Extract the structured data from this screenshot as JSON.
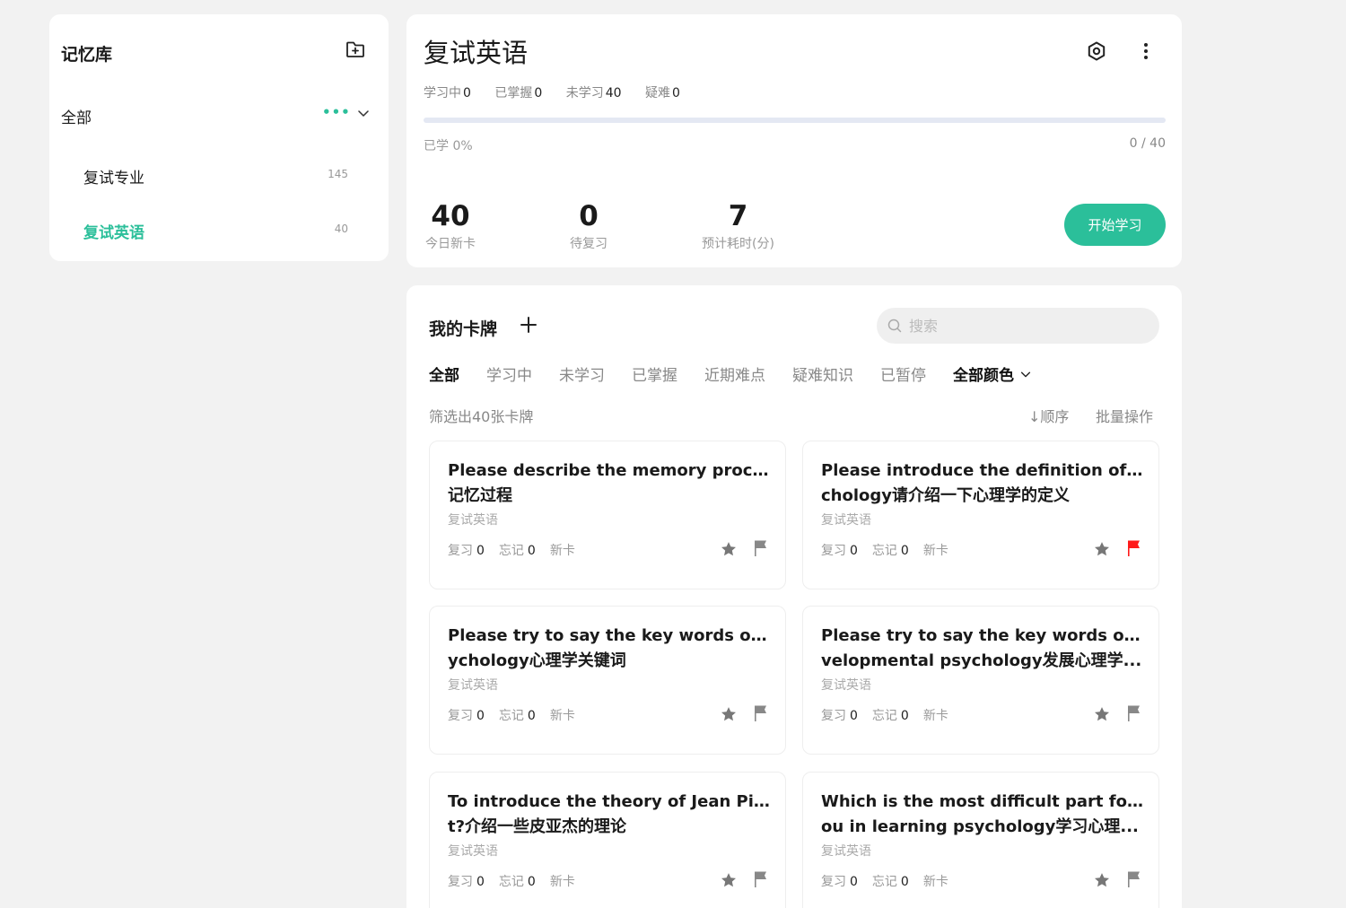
{
  "sidebar": {
    "title": "记忆库",
    "all_label": "全部",
    "items": [
      {
        "label": "复试专业",
        "count": "145"
      },
      {
        "label": "复试英语",
        "count": "40"
      }
    ]
  },
  "header": {
    "title": "复试英语",
    "stats": [
      {
        "label": "学习中",
        "value": "0"
      },
      {
        "label": "已掌握",
        "value": "0"
      },
      {
        "label": "未学习",
        "value": "40"
      },
      {
        "label": "疑难",
        "value": "0"
      }
    ],
    "progress_label": "已学 0%",
    "progress_fraction": 0,
    "progress_count": "0 / 40",
    "metrics": [
      {
        "value": "40",
        "label": "今日新卡"
      },
      {
        "value": "0",
        "label": "待复习"
      },
      {
        "value": "7",
        "label": "预计耗时(分)"
      }
    ],
    "start_label": "开始学习"
  },
  "cards_panel": {
    "title": "我的卡牌",
    "search_placeholder": "搜索",
    "tabs": [
      "全部",
      "学习中",
      "未学习",
      "已掌握",
      "近期难点",
      "疑难知识",
      "已暂停"
    ],
    "color_filter": "全部颜色",
    "count_text": "筛选出40张卡牌",
    "sort_label": "顺序",
    "batch_label": "批量操作",
    "review_label": "复习",
    "forget_label": "忘记",
    "cards": [
      {
        "line1": "Please describe the memory process",
        "line2": "记忆过程",
        "deck": "复试英语",
        "review": "0",
        "forget": "0",
        "status": "新卡",
        "flag_color": "#888888"
      },
      {
        "line1": "Please introduce the definition of psy",
        "line2": "chology请介绍一下心理学的定义",
        "deck": "复试英语",
        "review": "0",
        "forget": "0",
        "status": "新卡",
        "flag_color": "#ff1a1a"
      },
      {
        "line1": "Please try to say the key words of ps",
        "line2": "ychology心理学关键词",
        "deck": "复试英语",
        "review": "0",
        "forget": "0",
        "status": "新卡",
        "flag_color": "#888888"
      },
      {
        "line1": "Please try to say the key words of de",
        "line2": "velopmental psychology发展心理学...",
        "deck": "复试英语",
        "review": "0",
        "forget": "0",
        "status": "新卡",
        "flag_color": "#888888"
      },
      {
        "line1": "To introduce the theory of Jean Piage",
        "line2": "t?介绍一些皮亚杰的理论",
        "deck": "复试英语",
        "review": "0",
        "forget": "0",
        "status": "新卡",
        "flag_color": "#888888"
      },
      {
        "line1": "Which is the most difficult part for y",
        "line2": "ou in learning psychology学习心理...",
        "deck": "复试英语",
        "review": "0",
        "forget": "0",
        "status": "新卡",
        "flag_color": "#888888"
      }
    ]
  },
  "colors": {
    "accent": "#2bbf9a",
    "flag_red": "#ff1a1a"
  },
  "icons": {
    "add_folder": "folder-plus-icon",
    "settings": "gear-icon",
    "more": "more-vertical-icon",
    "search": "search-icon",
    "star": "star-icon",
    "flag": "flag-icon"
  }
}
